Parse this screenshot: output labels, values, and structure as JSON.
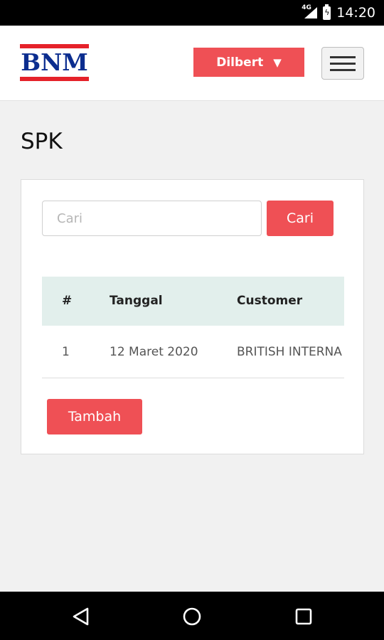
{
  "status_bar": {
    "network": "4G",
    "time": "14:20"
  },
  "header": {
    "logo_text": "BNM",
    "user_menu_label": "Dilbert",
    "user_menu_caret": "▼"
  },
  "page": {
    "title": "SPK"
  },
  "search": {
    "placeholder": "Cari",
    "value": "",
    "button_label": "Cari"
  },
  "table": {
    "columns": [
      "#",
      "Tanggal",
      "Customer"
    ],
    "rows": [
      [
        "1",
        "12 Maret 2020",
        "BRITISH INTERNA"
      ]
    ]
  },
  "actions": {
    "add_label": "Tambah"
  },
  "colors": {
    "accent": "#ef5055",
    "logo_blue": "#0b2d8f",
    "logo_red": "#e5222a",
    "table_header": "#e2efec"
  },
  "icons": {
    "nav_back": "triangle-back-icon",
    "nav_home": "circle-home-icon",
    "nav_recents": "square-recents-icon",
    "menu": "hamburger-icon"
  }
}
